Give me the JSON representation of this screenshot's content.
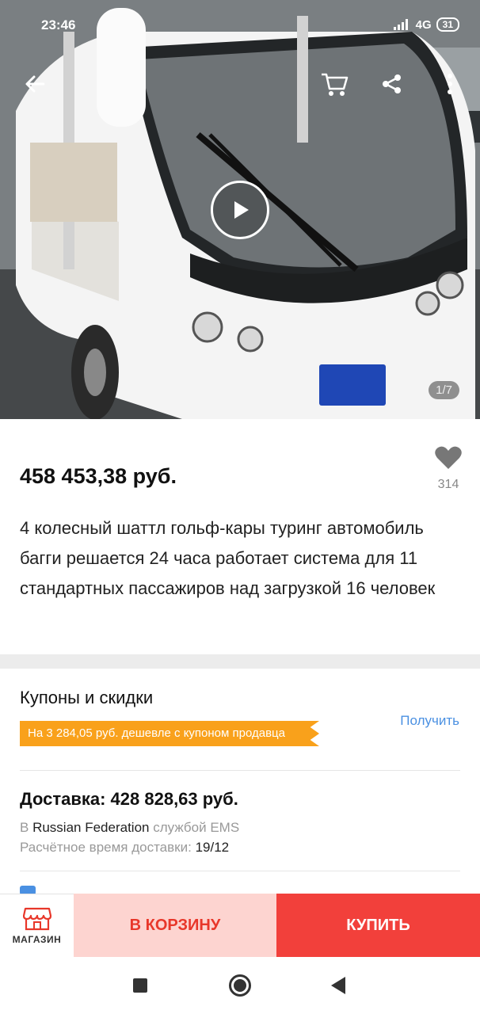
{
  "status_bar": {
    "time": "23:46",
    "network": "4G",
    "battery": "31"
  },
  "gallery": {
    "counter": "1/7",
    "icons": [
      "back-arrow-icon",
      "cart-icon",
      "share-icon",
      "more-vert-icon",
      "play-icon"
    ]
  },
  "product": {
    "price": "458 453,38 руб.",
    "wishlist_count": "314",
    "title": "4 колесный шаттл гольф-кары туринг автомобиль багги решается 24 часа работает система для 11 стандартных пассажиров над загрузкой 16 человек"
  },
  "coupons": {
    "heading": "Купоны и скидки",
    "get_label": "Получить",
    "tag_text": "На 3 284,05 руб. дешевле с купоном продавца"
  },
  "delivery": {
    "price_line": "Доставка: 428 828,63 руб.",
    "to_prefix": "В",
    "country": "Russian Federation",
    "service": "службой EMS",
    "estimate_label": "Расчётное время доставки:",
    "estimate_value": "19/12"
  },
  "action_bar": {
    "shop_label": "МАГАЗИН",
    "cart_label": "В КОРЗИНУ",
    "buy_label": "КУПИТЬ"
  },
  "colors": {
    "accent_red": "#f2403b",
    "cart_bg": "#fdd4d0",
    "coupon_orange": "#f9a11b",
    "link_blue": "#4a90e2"
  }
}
